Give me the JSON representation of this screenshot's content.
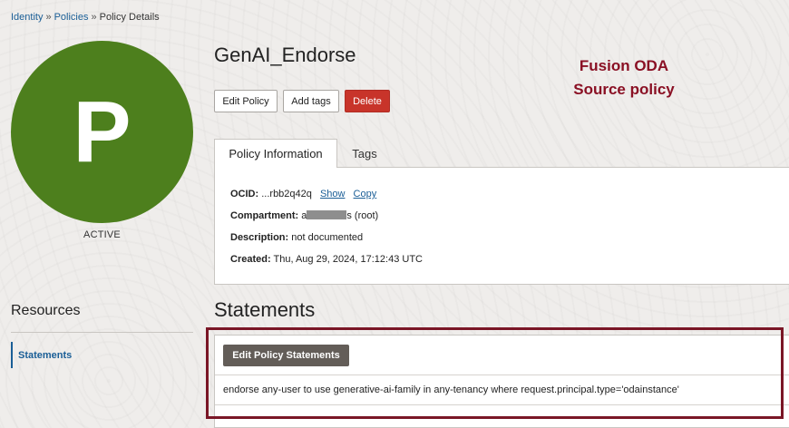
{
  "breadcrumb": {
    "items": [
      "Identity",
      "Policies",
      "Policy Details"
    ],
    "separator": "»"
  },
  "avatar": {
    "letter": "P",
    "color": "#4d7f1d"
  },
  "status": "ACTIVE",
  "policy": {
    "name": "GenAI_Endorse"
  },
  "annotation": {
    "line1": "Fusion ODA",
    "line2": "Source policy",
    "color": "#8a1024"
  },
  "actions": {
    "edit": "Edit Policy",
    "add_tags": "Add tags",
    "delete": "Delete"
  },
  "tabs": {
    "info": "Policy Information",
    "tags": "Tags"
  },
  "info": {
    "ocid_label": "OCID:",
    "ocid_value": "...rbb2q42q",
    "show": "Show",
    "copy": "Copy",
    "compartment_label": "Compartment:",
    "compartment_prefix": "a",
    "compartment_suffix": "s (root)",
    "description_label": "Description:",
    "description_value": "not documented",
    "created_label": "Created:",
    "created_value": "Thu, Aug 29, 2024, 17:12:43 UTC"
  },
  "resources": {
    "title": "Resources",
    "items": [
      "Statements"
    ]
  },
  "statements": {
    "title": "Statements",
    "edit_button": "Edit Policy Statements",
    "items": [
      "endorse any-user to use generative-ai-family in any-tenancy where request.principal.type='odainstance'"
    ]
  },
  "colors": {
    "link": "#1a5e96",
    "delete": "#c8342a",
    "highlight_border": "#7a1626",
    "dark_button": "#635d58"
  }
}
